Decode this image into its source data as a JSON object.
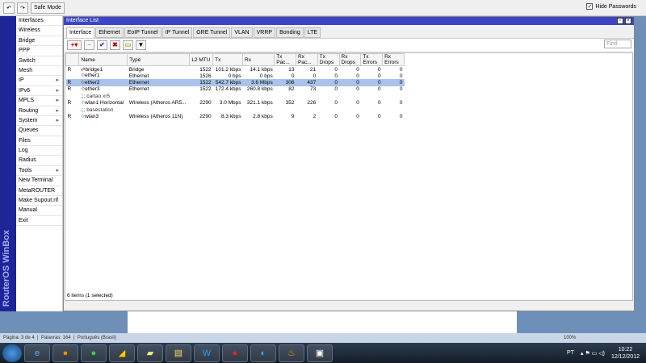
{
  "toolbar": {
    "undo": "↶",
    "redo": "↷",
    "safe_mode": "Safe Mode",
    "hide_passwords": "Hide Passwords",
    "hide_checked": true
  },
  "brand": "RouterOS WinBox",
  "sidebar": {
    "items": [
      {
        "label": "Interfaces"
      },
      {
        "label": "Wireless"
      },
      {
        "label": "Bridge"
      },
      {
        "label": "PPP"
      },
      {
        "label": "Switch"
      },
      {
        "label": "Mesh"
      },
      {
        "label": "IP",
        "sub": true
      },
      {
        "label": "IPv6",
        "sub": true
      },
      {
        "label": "MPLS",
        "sub": true
      },
      {
        "label": "Routing",
        "sub": true
      },
      {
        "label": "System",
        "sub": true
      },
      {
        "label": "Queues"
      },
      {
        "label": "Files"
      },
      {
        "label": "Log"
      },
      {
        "label": "Radius"
      },
      {
        "label": "Tools",
        "sub": true
      },
      {
        "label": "New Terminal"
      },
      {
        "label": "MetaROUTER"
      },
      {
        "label": "Make Supout.rif"
      },
      {
        "label": "Manual"
      },
      {
        "label": "Exit"
      }
    ]
  },
  "window": {
    "title": "Interface List",
    "tabs": [
      "Interface",
      "Ethernet",
      "EoIP Tunnel",
      "IP Tunnel",
      "GRE Tunnel",
      "VLAN",
      "VRRP",
      "Bonding",
      "LTE"
    ],
    "active_tab": "Interface",
    "find_placeholder": "Find",
    "columns": [
      "",
      "Name",
      "Type",
      "L2 MTU",
      "Tx",
      "Rx",
      "Tx Pac...",
      "Rx Pac...",
      "Tx Drops",
      "Rx Drops",
      "Tx Errors",
      "Rx Errors"
    ],
    "rows": [
      {
        "flag": "R",
        "name": "bridge1",
        "type": "Bridge",
        "mtu": "1522",
        "tx": "101.2 kbps",
        "rx": "14.1 kbps",
        "txp": "13",
        "rxp": "21",
        "txd": "0",
        "rxd": "0",
        "txe": "0",
        "rxe": "0"
      },
      {
        "flag": "",
        "name": "ether1",
        "type": "Ethernet",
        "mtu": "1526",
        "tx": "0 bps",
        "rx": "0 bps",
        "txp": "0",
        "rxp": "0",
        "txd": "0",
        "rxd": "0",
        "txe": "0",
        "rxe": "0"
      },
      {
        "flag": "R",
        "name": "ether2",
        "type": "Ethernet",
        "mtu": "1522",
        "tx": "542.7 kbps",
        "rx": "3.6 Mbps",
        "txp": "306",
        "rxp": "437",
        "txd": "0",
        "rxd": "0",
        "txe": "0",
        "rxe": "0",
        "selected": true
      },
      {
        "flag": "R",
        "name": "ether3",
        "type": "Ethernet",
        "mtu": "1522",
        "tx": "172.4 kbps",
        "rx": "260.8 kbps",
        "txp": "82",
        "rxp": "73",
        "txd": "0",
        "rxd": "0",
        "txe": "0",
        "rxe": "0"
      },
      {
        "comment": ";;; cartao xr5"
      },
      {
        "flag": "R",
        "name": "wlan1 Horizontal",
        "type": "Wireless (Atheros AR5...",
        "mtu": "2290",
        "tx": "3.0 Mbps",
        "rx": "321.1 kbps",
        "txp": "352",
        "rxp": "226",
        "txd": "0",
        "rxd": "0",
        "txe": "0",
        "rxe": "0"
      },
      {
        "comment": ";;; basestation"
      },
      {
        "flag": "R",
        "name": "wlan3",
        "type": "Wireless (Atheros 11N)",
        "mtu": "2290",
        "tx": "8.3 kbps",
        "rx": "2.8 kbps",
        "txp": "9",
        "rxp": "2",
        "txd": "0",
        "rxd": "0",
        "txe": "0",
        "rxe": "0"
      }
    ],
    "status": "6 items (1 selected)"
  },
  "word_status": {
    "page": "Página: 3 de 4",
    "words": "Palavras: 164",
    "language": "Português (Brasil)",
    "zoom": "100%"
  },
  "taskbar": {
    "lang": "PT",
    "time": "10:22",
    "date": "12/12/2012"
  }
}
